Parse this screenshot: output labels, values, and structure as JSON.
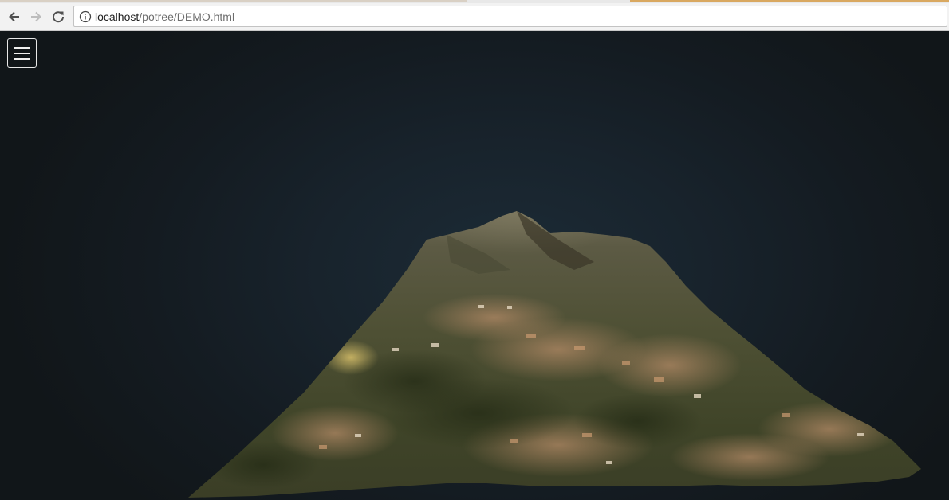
{
  "browser": {
    "url_host": "localhost",
    "url_path": "/potree/DEMO.html",
    "icons": {
      "back": "arrow-left-icon",
      "forward": "arrow-right-icon",
      "reload": "reload-icon",
      "site_info": "info-icon"
    }
  },
  "viewer": {
    "menu_icon": "hamburger-menu-icon",
    "background_color": "#1a2630",
    "scene": "point-cloud-terrain"
  }
}
